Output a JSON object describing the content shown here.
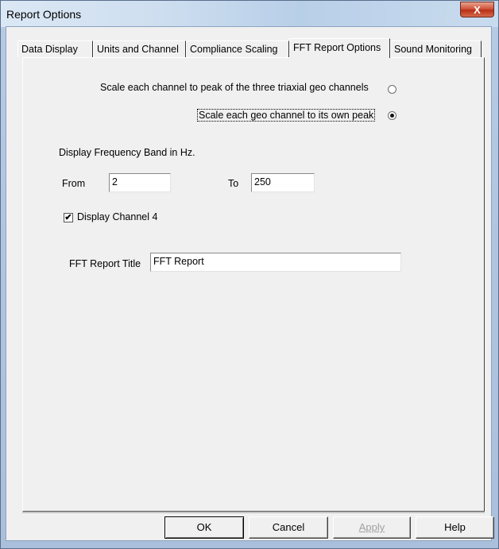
{
  "window": {
    "title": "Report Options",
    "close_label": "X"
  },
  "tabs": [
    {
      "label": "Data Display",
      "active": false
    },
    {
      "label": "Units and Channel",
      "active": false
    },
    {
      "label": "Compliance Scaling",
      "active": false
    },
    {
      "label": "FFT Report Options",
      "active": true
    },
    {
      "label": "Sound Monitoring",
      "active": false
    }
  ],
  "scaling": {
    "option1_label": "Scale each channel to peak of the three triaxial geo channels",
    "option1_checked": false,
    "option2_label": "Scale each geo channel to its own peak",
    "option2_checked": true
  },
  "frequency_band": {
    "heading": "Display Frequency Band in Hz.",
    "from_label": "From",
    "from_value": "2",
    "to_label": "To",
    "to_value": "250"
  },
  "channel4": {
    "label": "Display Channel 4",
    "checked": true,
    "check_glyph": "✔"
  },
  "report_title": {
    "label": "FFT Report Title",
    "value": "FFT Report"
  },
  "buttons": {
    "ok": "OK",
    "cancel": "Cancel",
    "apply": "Apply",
    "help": "Help"
  }
}
